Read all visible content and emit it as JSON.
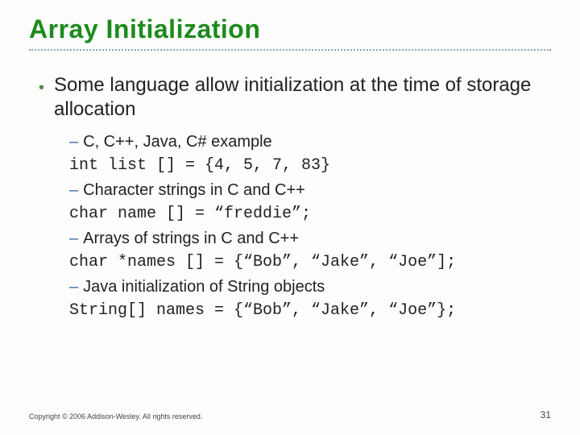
{
  "title": "Array Initialization",
  "bullet1": "Some language allow initialization at the time of storage allocation",
  "sub": [
    {
      "type": "text",
      "value": "C, C++, Java, C# example"
    },
    {
      "type": "code",
      "value": "int list [] = {4, 5, 7, 83}"
    },
    {
      "type": "text",
      "value": "Character strings in C and C++"
    },
    {
      "type": "code",
      "value": "char name [] = “freddie”;"
    },
    {
      "type": "text",
      "value": "Arrays of strings in C and C++"
    },
    {
      "type": "code",
      "value": "char *names [] = {“Bob”, “Jake”, “Joe”];"
    },
    {
      "type": "text",
      "value": "Java initialization of String objects"
    },
    {
      "type": "code",
      "value": "String[] names = {“Bob”, “Jake”, “Joe”};"
    }
  ],
  "footer": "Copyright © 2006 Addison-Wesley. All rights reserved.",
  "pagenum": "31"
}
